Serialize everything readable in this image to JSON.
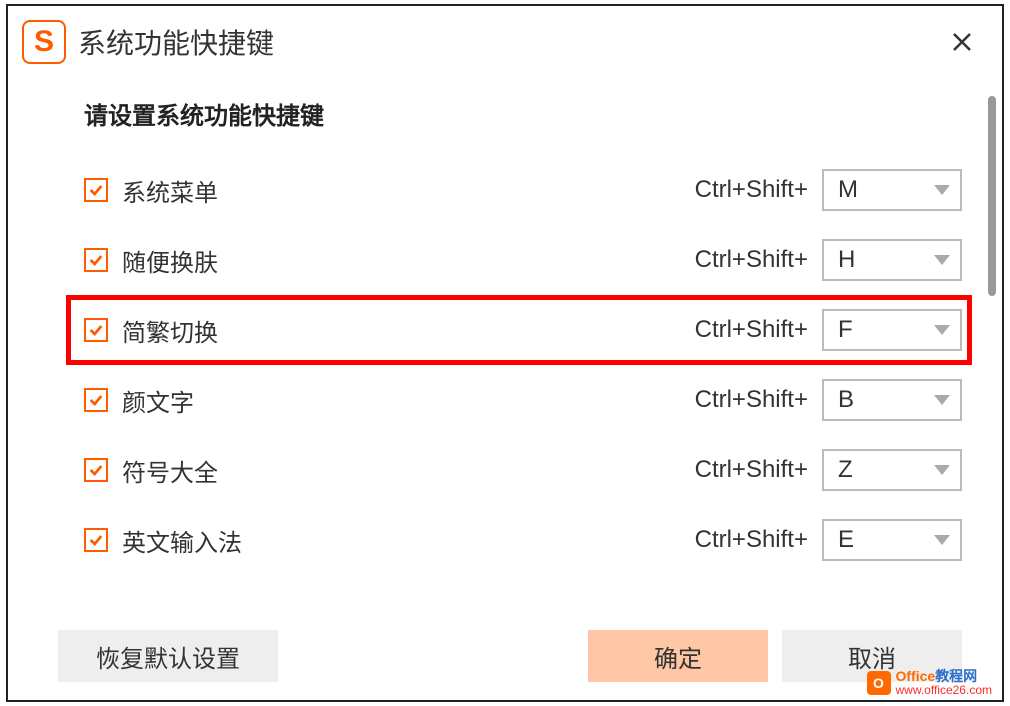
{
  "header": {
    "app_icon_letter": "S",
    "title": "系统功能快捷键"
  },
  "subtitle": "请设置系统功能快捷键",
  "shortcuts": [
    {
      "label": "系统菜单",
      "modifier": "Ctrl+Shift+",
      "key": "M",
      "checked": true,
      "highlight": false
    },
    {
      "label": "随便换肤",
      "modifier": "Ctrl+Shift+",
      "key": "H",
      "checked": true,
      "highlight": false
    },
    {
      "label": "简繁切换",
      "modifier": "Ctrl+Shift+",
      "key": "F",
      "checked": true,
      "highlight": true
    },
    {
      "label": "颜文字",
      "modifier": "Ctrl+Shift+",
      "key": "B",
      "checked": true,
      "highlight": false
    },
    {
      "label": "符号大全",
      "modifier": "Ctrl+Shift+",
      "key": "Z",
      "checked": true,
      "highlight": false
    },
    {
      "label": "英文输入法",
      "modifier": "Ctrl+Shift+",
      "key": "E",
      "checked": true,
      "highlight": false
    }
  ],
  "footer": {
    "restore_label": "恢复默认设置",
    "ok_label": "确定",
    "cancel_label": "取消"
  },
  "watermark": {
    "brand_prefix": "Office",
    "brand_suffix": "教程网",
    "url": "www.office26.com"
  }
}
